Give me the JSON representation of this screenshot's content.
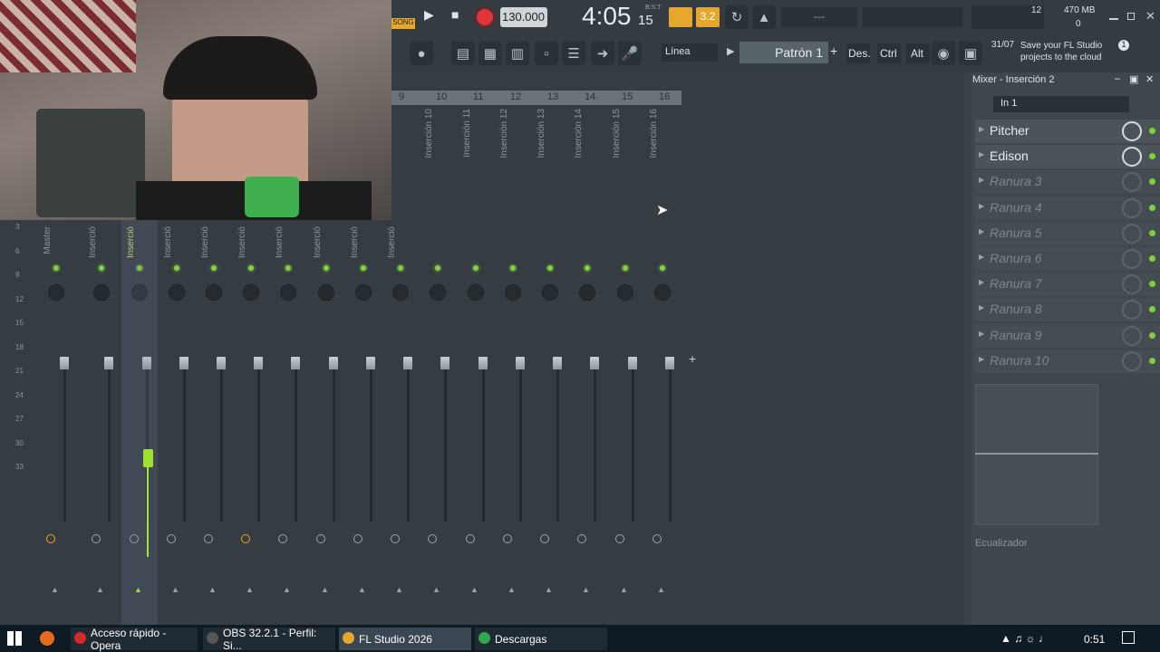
{
  "transport": {
    "song_label": "SONG",
    "tempo": "130.000",
    "time": "4:05",
    "time_small": "15",
    "time_unit": "B:S:T",
    "snap_value": "3.2",
    "mem": "470 MB",
    "cpu_num": "12",
    "poly": "0",
    "dash": "---"
  },
  "toolbar2": {
    "snap": "Línea",
    "pattern": "Patrón 1",
    "des": "Des.",
    "ctrl": "Ctrl",
    "alt": "Alt",
    "news_date": "31/07",
    "news_text": "Save your FL Studio projects to the cloud",
    "news_count": "1"
  },
  "ruler": [
    "9",
    "10",
    "11",
    "12",
    "13",
    "14",
    "15",
    "16"
  ],
  "strips": [
    "Master",
    "Inserció",
    "Inserció",
    "Inserció",
    "Inserció",
    "Inserció",
    "Inserció",
    "Inserció",
    "Inserció",
    "Inserció",
    "Inserción 10",
    "Inserción 11",
    "Inserción 12",
    "Inserción 13",
    "Inserción 14",
    "Inserción 15",
    "Inserción 16"
  ],
  "db_scale": [
    "3",
    "6",
    "9",
    "12",
    "15",
    "18",
    "21",
    "24",
    "27",
    "30",
    "33"
  ],
  "panel": {
    "title": "Mixer - Inserción 2",
    "input": "In 1",
    "slots": [
      "Pitcher",
      "Edison",
      "Ranura 3",
      "Ranura 4",
      "Ranura 5",
      "Ranura 6",
      "Ranura 7",
      "Ranura 8",
      "Ranura 9",
      "Ranura 10"
    ],
    "eq_label": "Ecualizador"
  },
  "taskbar": {
    "items": [
      "Acceso rápido - Opera",
      "OBS 32.2.1 - Perfil: Si...",
      "FL Studio 2026",
      "Descargas"
    ],
    "clock": "0:51"
  },
  "colors": {
    "accent_green": "#7fd13a",
    "accent_orange": "#f0a020",
    "record_red": "#e0333a"
  }
}
